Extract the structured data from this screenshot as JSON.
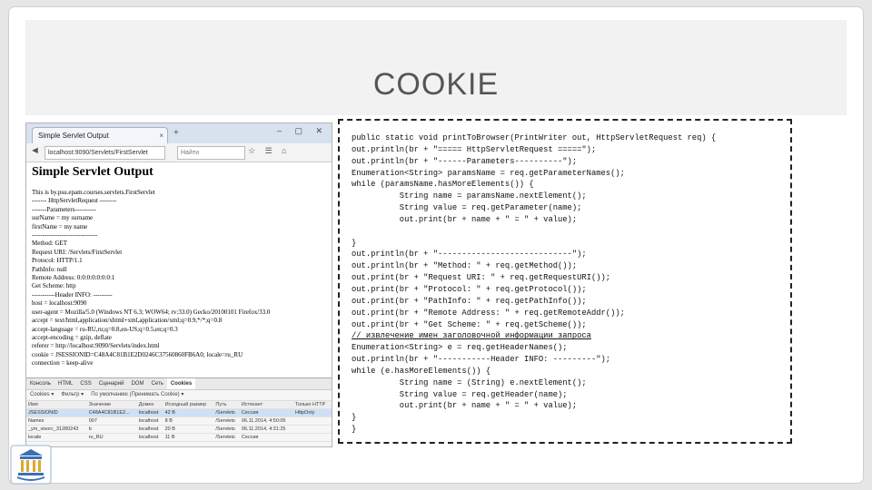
{
  "slide": {
    "title": "COOKIE"
  },
  "browser": {
    "tab_title": "Simple Servlet Output",
    "tab_close": "×",
    "new_tab": "+",
    "url": "localhost:9090/Servlets/FirstServlet",
    "search_placeholder": "Найти",
    "window_controls": "–  ▢  ✕"
  },
  "page": {
    "heading": "Simple Servlet Output",
    "lines": [
      "This is by.psu.epam.courses.servlets.FirstServlet",
      "------- HttpServletRequest --------",
      "-------Parameters----------",
      "surName = my surname",
      "firstName = my name",
      "-------------------------------",
      "Method: GET",
      "Request URI: /Servlets/FirstServlet",
      "Protocol: HTTP/1.1",
      "PathInfo: null",
      "Remote Address: 0:0:0:0:0:0:0:1",
      "Get Scheme: http",
      "-----------Header INFO: ---------",
      "host = localhost:9090",
      "user-agent = Mozilla/5.0 (Windows NT 6.3; WOW64; rv:33.0) Gecko/20100101 Firefox/33.0",
      "accept = text/html,application/xhtml+xml,application/xml;q=0.9,*/*;q=0.8",
      "accept-language = ru-RU,ru;q=0.8,en-US;q=0.5,en;q=0.3",
      "accept-encoding = gzip, deflate",
      "referer = http://localhost:9090/Servlets/index.html",
      "cookie = JSESSIONID=C48A4C81B1E2D0246C37560860FB6A0; locale=ru_RU",
      "connection = keep-alive"
    ]
  },
  "devtools": {
    "tabs": [
      "Консоль",
      "HTML",
      "CSS",
      "Сценарий",
      "DOM",
      "Сеть",
      "Cookies"
    ],
    "active_tab": "Cookies",
    "toolbar": [
      "Cookies ▾",
      "Фильтр ▾",
      "По умолчанию (Принимать Cookie) ▾"
    ],
    "columns": [
      "Имя",
      "Значение",
      "Домен",
      "Исходный размер",
      "Путь",
      "Истекает",
      "Только HTTP"
    ],
    "rows": [
      [
        "JSESSIONID",
        "C48A4C81B1E2...",
        "localhost",
        "42 B",
        "/Servlets",
        "Сессия",
        "HttpOnly"
      ],
      [
        "Names",
        "007",
        "localhost",
        "8 B",
        "/Servlets",
        "06.11.2014, 4:50:05",
        ""
      ],
      [
        "_ym_visorc_31280243",
        "b",
        "localhost",
        "20 B",
        "/Servlets",
        "06.11.2014, 4:31:25",
        ""
      ],
      [
        "locale",
        "ru_RU",
        "localhost",
        "11 B",
        "/Servlets",
        "Сессия",
        ""
      ]
    ]
  },
  "code": {
    "lines": [
      "public static void printToBrowser(PrintWriter out, HttpServletRequest req) {",
      "out.println(br + \"===== HttpServletRequest =====\");",
      "out.println(br + \"------Parameters----------\");",
      "Enumeration<String> paramsName = req.getParameterNames();",
      "while (paramsName.hasMoreElements()) {",
      "          String name = paramsName.nextElement();",
      "          String value = req.getParameter(name);",
      "          out.print(br + name + \" = \" + value);",
      "",
      "}",
      "out.println(br + \"----------------------------\");",
      "out.println(br + \"Method: \" + req.getMethod());",
      "out.print(br + \"Request URI: \" + req.getRequestURI());",
      "out.print(br + \"Protocol: \" + req.getProtocol());",
      "out.print(br + \"PathInfo: \" + req.getPathInfo());",
      "out.print(br + \"Remote Address: \" + req.getRemoteAddr());",
      "out.print(br + \"Get Scheme: \" + req.getScheme());",
      "// извлечение имен заголовочной информации запроса",
      "Enumeration<String> e = req.getHeaderNames();",
      "out.println(br + \"-----------Header INFO: ---------\");",
      "while (e.hasMoreElements()) {",
      "          String name = (String) e.nextElement();",
      "          String value = req.getHeader(name);",
      "          out.print(br + name + \" = \" + value);",
      "}",
      "}"
    ],
    "comment_line_index": 17
  }
}
